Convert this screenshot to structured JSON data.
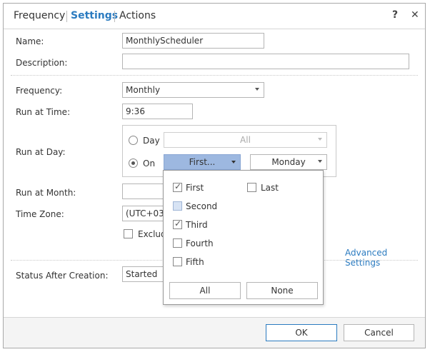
{
  "tabs": [
    "Frequency",
    "Settings",
    "Actions"
  ],
  "help_label": "?",
  "close_label": "✕",
  "form": {
    "name_label": "Name:",
    "name_value": "MonthlyScheduler",
    "description_label": "Description:",
    "description_value": "",
    "frequency_label": "Frequency:",
    "frequency_value": "Monthly",
    "run_at_time_label": "Run at Time:",
    "run_at_time_value": "9:36",
    "run_at_day_label": "Run at Day:",
    "day_option_label": "Day",
    "day_select_value": "All",
    "on_option_label": "On",
    "on_ordinal_value": "First...",
    "on_weekday_value": "Monday",
    "run_at_month_label": "Run at Month:",
    "time_zone_label": "Time Zone:",
    "time_zone_value": "(UTC+03:0",
    "exclude_label": "Exclude",
    "advanced_settings_label": "Advanced Settings",
    "status_label": "Status After Creation:",
    "status_value": "Started"
  },
  "ordinal_popup": {
    "options": [
      {
        "label": "First",
        "checked": true
      },
      {
        "label": "Second",
        "checked": false
      },
      {
        "label": "Third",
        "checked": true
      },
      {
        "label": "Fourth",
        "checked": false
      },
      {
        "label": "Fifth",
        "checked": false
      },
      {
        "label": "Last",
        "checked": false
      }
    ],
    "all_label": "All",
    "none_label": "None"
  },
  "footer": {
    "ok_label": "OK",
    "cancel_label": "Cancel"
  },
  "colors": {
    "accent": "#2b7bc0",
    "selected_button": "#9db8e0"
  }
}
